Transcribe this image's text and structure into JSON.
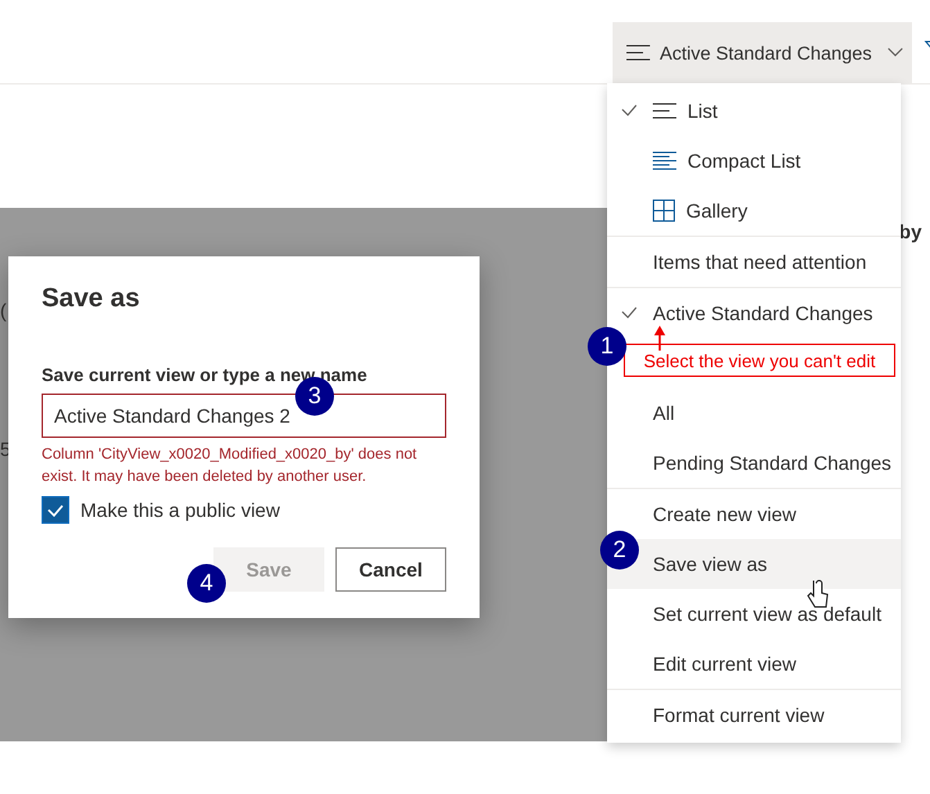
{
  "view_switcher": {
    "label": "Active Standard Changes"
  },
  "background": {
    "column_header": "by",
    "fragments": [
      "(",
      "5"
    ]
  },
  "menu": {
    "sections": [
      [
        {
          "kind": "list",
          "label": "List",
          "checked": true,
          "highlighted": false
        },
        {
          "kind": "compact",
          "label": "Compact List",
          "checked": false,
          "highlighted": false
        },
        {
          "kind": "gallery",
          "label": "Gallery",
          "checked": false,
          "highlighted": false
        }
      ],
      [
        {
          "kind": "view",
          "label": "Items that need attention",
          "checked": false,
          "highlighted": false
        }
      ],
      [
        {
          "kind": "view",
          "label": "Active Standard Changes",
          "checked": true,
          "highlighted": false,
          "annotation": "Select the view you can't edit"
        },
        {
          "kind": "view",
          "label": "All",
          "checked": false,
          "highlighted": false
        },
        {
          "kind": "view",
          "label": "Pending Standard Changes",
          "checked": false,
          "highlighted": false
        }
      ],
      [
        {
          "kind": "view",
          "label": "Create new view",
          "checked": false,
          "highlighted": false
        },
        {
          "kind": "view",
          "label": "Save view as",
          "checked": false,
          "highlighted": true
        },
        {
          "kind": "view",
          "label": "Set current view as default",
          "checked": false,
          "highlighted": false
        },
        {
          "kind": "view",
          "label": "Edit current view",
          "checked": false,
          "highlighted": false
        }
      ],
      [
        {
          "kind": "view",
          "label": "Format current view",
          "checked": false,
          "highlighted": false
        }
      ]
    ]
  },
  "dialog": {
    "title": "Save as",
    "field_label": "Save current view or type a new name",
    "field_value": "Active Standard Changes 2",
    "error": "Column 'CityView_x0020_Modified_x0020_by' does not exist. It may have been deleted by another user.",
    "checkbox": {
      "label": "Make this a public view",
      "checked": true
    },
    "buttons": [
      {
        "label": "Save",
        "disabled": true
      },
      {
        "label": "Cancel",
        "disabled": false
      }
    ]
  },
  "annotations": {
    "markers": [
      "1",
      "2",
      "3",
      "4"
    ]
  }
}
